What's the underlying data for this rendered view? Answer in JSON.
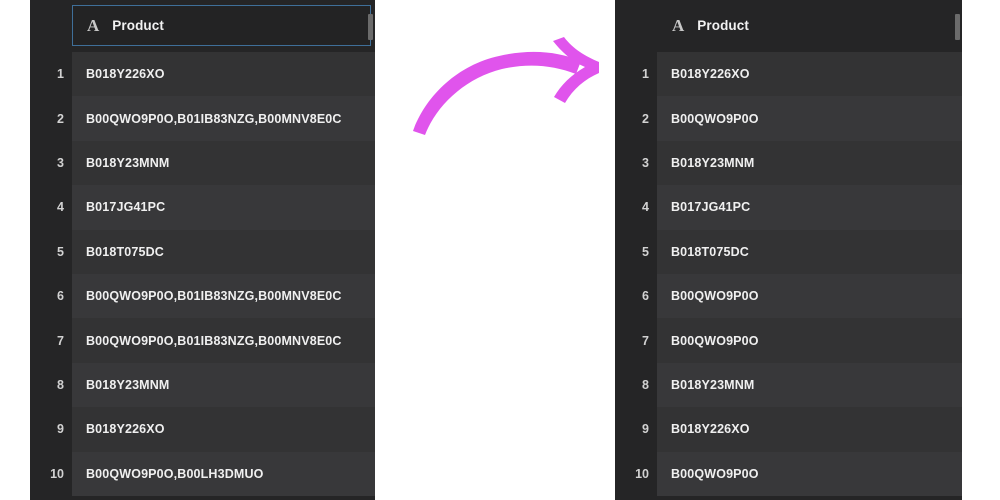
{
  "left_table": {
    "column": {
      "icon": "text-type-icon",
      "icon_glyph": "A",
      "label": "Product",
      "selected": true
    },
    "rows": [
      {
        "num": "1",
        "value": "B018Y226XO"
      },
      {
        "num": "2",
        "value": "B00QWO9P0O,B01IB83NZG,B00MNV8E0C"
      },
      {
        "num": "3",
        "value": "B018Y23MNM"
      },
      {
        "num": "4",
        "value": "B017JG41PC"
      },
      {
        "num": "5",
        "value": "B018T075DC"
      },
      {
        "num": "6",
        "value": "B00QWO9P0O,B01IB83NZG,B00MNV8E0C"
      },
      {
        "num": "7",
        "value": "B00QWO9P0O,B01IB83NZG,B00MNV8E0C"
      },
      {
        "num": "8",
        "value": "B018Y23MNM"
      },
      {
        "num": "9",
        "value": "B018Y226XO"
      },
      {
        "num": "10",
        "value": "B00QWO9P0O,B00LH3DMUO"
      }
    ]
  },
  "right_table": {
    "column": {
      "icon": "text-type-icon",
      "icon_glyph": "A",
      "label": "Product",
      "selected": false
    },
    "rows": [
      {
        "num": "1",
        "value": "B018Y226XO"
      },
      {
        "num": "2",
        "value": "B00QWO9P0O"
      },
      {
        "num": "3",
        "value": "B018Y23MNM"
      },
      {
        "num": "4",
        "value": "B017JG41PC"
      },
      {
        "num": "5",
        "value": "B018T075DC"
      },
      {
        "num": "6",
        "value": "B00QWO9P0O"
      },
      {
        "num": "7",
        "value": "B00QWO9P0O"
      },
      {
        "num": "8",
        "value": "B018Y23MNM"
      },
      {
        "num": "9",
        "value": "B018Y226XO"
      },
      {
        "num": "10",
        "value": "B00QWO9P0O"
      }
    ]
  },
  "annotation": {
    "arrow": {
      "name": "curved-arrow-right",
      "color": "#e054ec",
      "direction": "left-to-right"
    }
  },
  "colors": {
    "panel_bg": "#252526",
    "row_odd": "#333334",
    "row_even": "#38383a",
    "text": "#f0f0f0",
    "selection_border": "#3f6f99",
    "accent": "#e054ec"
  }
}
